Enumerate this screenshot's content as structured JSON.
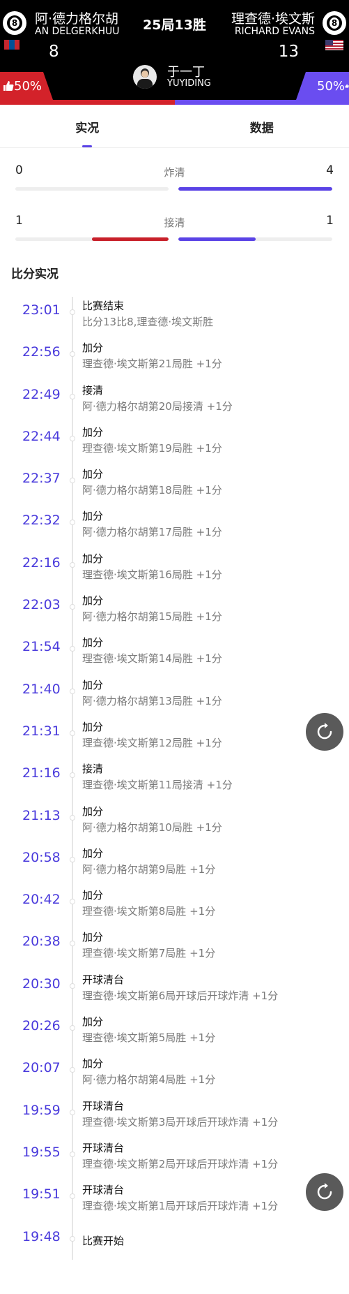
{
  "header": {
    "match_title": "25局13胜",
    "left_player": {
      "name_cn": "阿·德力格尔胡",
      "name_en": "AN DELGERKHUU",
      "score": "8",
      "flag_icon": "mongolia-flag-icon",
      "ball_number": "8"
    },
    "right_player": {
      "name_cn": "理查德·埃文斯",
      "name_en": "RICHARD EVANS",
      "score": "13",
      "flag_icon": "usa-flag-icon",
      "ball_number": "8"
    },
    "referee": {
      "name_cn": "于一丁",
      "name_en": "YUYIDING"
    },
    "left_support": "50%",
    "right_support": "50%",
    "support_left_fraction": 0.5,
    "colors": {
      "left": "#d3222a",
      "right": "#6a4df0",
      "accent": "#5a43e6"
    }
  },
  "tabs": [
    {
      "label": "实况",
      "active": true
    },
    {
      "label": "数据",
      "active": false
    }
  ],
  "stats": [
    {
      "label": "炸清",
      "left": "0",
      "right": "4",
      "left_fraction": 0.0,
      "right_fraction": 1.0
    },
    {
      "label": "接清",
      "left": "1",
      "right": "1",
      "left_fraction": 0.5,
      "right_fraction": 0.5
    }
  ],
  "section_title": "比分实况",
  "events": [
    {
      "time": "23:01",
      "title": "比赛结束",
      "detail": "比分13比8,理查德·埃文斯胜"
    },
    {
      "time": "22:56",
      "title": "加分",
      "detail": "理查德·埃文斯第21局胜 +1分"
    },
    {
      "time": "22:49",
      "title": "接清",
      "detail": "阿·德力格尔胡第20局接清 +1分"
    },
    {
      "time": "22:44",
      "title": "加分",
      "detail": "理查德·埃文斯第19局胜 +1分"
    },
    {
      "time": "22:37",
      "title": "加分",
      "detail": "阿·德力格尔胡第18局胜 +1分"
    },
    {
      "time": "22:32",
      "title": "加分",
      "detail": "阿·德力格尔胡第17局胜 +1分"
    },
    {
      "time": "22:16",
      "title": "加分",
      "detail": "理查德·埃文斯第16局胜 +1分"
    },
    {
      "time": "22:03",
      "title": "加分",
      "detail": "阿·德力格尔胡第15局胜 +1分"
    },
    {
      "time": "21:54",
      "title": "加分",
      "detail": "理查德·埃文斯第14局胜 +1分"
    },
    {
      "time": "21:40",
      "title": "加分",
      "detail": "阿·德力格尔胡第13局胜 +1分"
    },
    {
      "time": "21:31",
      "title": "加分",
      "detail": "理查德·埃文斯第12局胜 +1分"
    },
    {
      "time": "21:16",
      "title": "接清",
      "detail": "理查德·埃文斯第11局接清 +1分"
    },
    {
      "time": "21:13",
      "title": "加分",
      "detail": "阿·德力格尔胡第10局胜 +1分"
    },
    {
      "time": "20:58",
      "title": "加分",
      "detail": "阿·德力格尔胡第9局胜 +1分"
    },
    {
      "time": "20:42",
      "title": "加分",
      "detail": "理查德·埃文斯第8局胜 +1分"
    },
    {
      "time": "20:38",
      "title": "加分",
      "detail": "理查德·埃文斯第7局胜 +1分"
    },
    {
      "time": "20:30",
      "title": "开球清台",
      "detail": "理查德·埃文斯第6局开球后开球炸清 +1分"
    },
    {
      "time": "20:26",
      "title": "加分",
      "detail": "理查德·埃文斯第5局胜 +1分"
    },
    {
      "time": "20:07",
      "title": "加分",
      "detail": "阿·德力格尔胡第4局胜 +1分"
    },
    {
      "time": "19:59",
      "title": "开球清台",
      "detail": "理查德·埃文斯第3局开球后开球炸清 +1分"
    },
    {
      "time": "19:55",
      "title": "开球清台",
      "detail": "理查德·埃文斯第2局开球后开球炸清 +1分"
    },
    {
      "time": "19:51",
      "title": "开球清台",
      "detail": "理查德·埃文斯第1局开球后开球炸清 +1分"
    },
    {
      "time": "19:48",
      "title": "比赛开始",
      "detail": ""
    }
  ],
  "refresh_icon": "refresh-icon"
}
